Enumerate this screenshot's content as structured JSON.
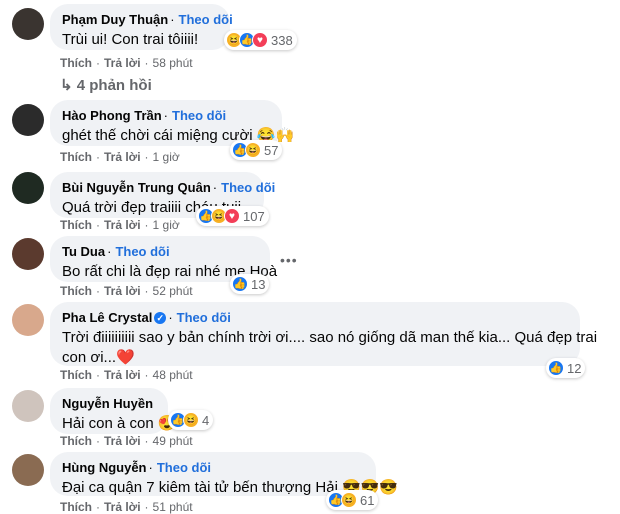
{
  "follow_label": "Theo dõi",
  "like_label": "Thích",
  "reply_label": "Trả lời",
  "comments": [
    {
      "name": "Phạm Duy Thuận",
      "text": "Trùi ui! Con trai tôiiii!",
      "time": "58 phút",
      "reactions": [
        "haha",
        "like",
        "love"
      ],
      "count": "338",
      "avatar_color": "#3a3430"
    },
    {
      "name": "Hào Phong Trần",
      "text": "ghét thế chời cái miệng cười 😂🙌",
      "time": "1 giờ",
      "reactions": [
        "like",
        "haha"
      ],
      "count": "57",
      "avatar_color": "#2b2b2b"
    },
    {
      "name": "Bùi Nguyễn Trung Quân",
      "text": "Quá trời đẹp traiiii cháu tuii",
      "time": "1 giờ",
      "reactions": [
        "like",
        "haha",
        "love"
      ],
      "count": "107",
      "avatar_color": "#1f2a22"
    },
    {
      "name": "Tu Dua",
      "text": "Bo rất chi là đẹp rai nhé mẹ Hoà",
      "time": "52 phút",
      "reactions": [
        "like"
      ],
      "count": "13",
      "avatar_color": "#5b3a2e"
    },
    {
      "name": "Pha Lê Crystal",
      "text": "Trời điiiiiiiiii sao y bản chính trời ơi.... sao nó giống dã man thế kia... Quá đẹp trai",
      "text2": "con ơi...❤️",
      "time": "48 phút",
      "reactions": [
        "like"
      ],
      "count": "12",
      "avatar_color": "#d8a88c",
      "verified": true
    },
    {
      "name": "Nguyễn Huyền",
      "text": "Hải con à con 😍",
      "time": "49 phút",
      "reactions": [
        "like",
        "haha"
      ],
      "count": "4",
      "avatar_color": "#cfc4bd"
    },
    {
      "name": "Hùng Nguyễn",
      "text": "Đại ca quận 7 kiêm tài tử bến thượng Hải 😎😎😎",
      "time": "51 phút",
      "reactions": [
        "like",
        "haha"
      ],
      "count": "61",
      "avatar_color": "#8a6b52"
    }
  ],
  "replies_label": "4 phản hồi",
  "more_label": "•••"
}
